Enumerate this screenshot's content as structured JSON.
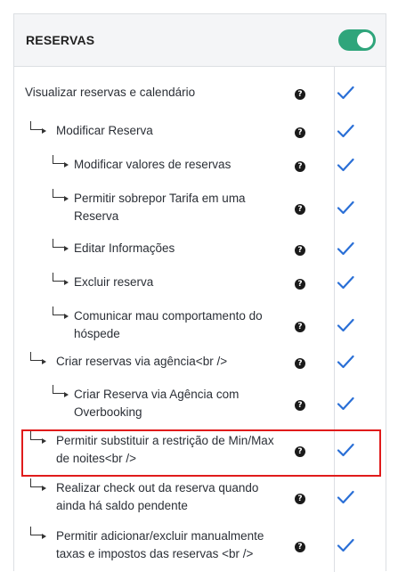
{
  "section": {
    "title": "RESERVAS",
    "toggle_on": true,
    "toggle_color": "#2fa57b"
  },
  "colors": {
    "check": "#2a6fd6",
    "highlight_border": "#e01b1b"
  },
  "permissions": [
    {
      "lines": [
        "Visualizar reservas e calendário"
      ],
      "level": 0,
      "checked": true,
      "help_icon": "?"
    },
    {
      "lines": [
        "Modificar Reserva"
      ],
      "level": 1,
      "checked": true,
      "help_icon": "?"
    },
    {
      "lines": [
        "Modificar valores de reservas"
      ],
      "level": 2,
      "checked": true,
      "help_icon": "?"
    },
    {
      "lines": [
        "Permitir sobrepor Tarifa em uma",
        "Reserva"
      ],
      "level": 2,
      "checked": true,
      "help_icon": "?"
    },
    {
      "lines": [
        "Editar Informações"
      ],
      "level": 2,
      "checked": true,
      "help_icon": "?"
    },
    {
      "lines": [
        "Excluir reserva"
      ],
      "level": 2,
      "checked": true,
      "help_icon": "?"
    },
    {
      "lines": [
        "Comunicar mau comportamento do",
        "hóspede"
      ],
      "level": 2,
      "checked": true,
      "help_icon": "?"
    },
    {
      "lines": [
        "Criar reservas via agência<br />"
      ],
      "level": 1,
      "checked": true,
      "help_icon": "?"
    },
    {
      "lines": [
        "Criar Reserva via Agência com",
        "Overbooking"
      ],
      "level": 2,
      "checked": true,
      "help_icon": "?"
    },
    {
      "lines": [
        "Permitir substituir a restrição de Min/Max",
        "de noites<br />"
      ],
      "level": 1,
      "checked": true,
      "help_icon": "?",
      "highlighted": true
    },
    {
      "lines": [
        "Realizar check out da reserva quando",
        "ainda há saldo pendente"
      ],
      "level": 1,
      "checked": true,
      "help_icon": "?"
    },
    {
      "lines": [
        "Permitir adicionar/excluir manualmente",
        "taxas e impostos das reservas <br />"
      ],
      "level": 1,
      "checked": true,
      "help_icon": "?"
    }
  ]
}
